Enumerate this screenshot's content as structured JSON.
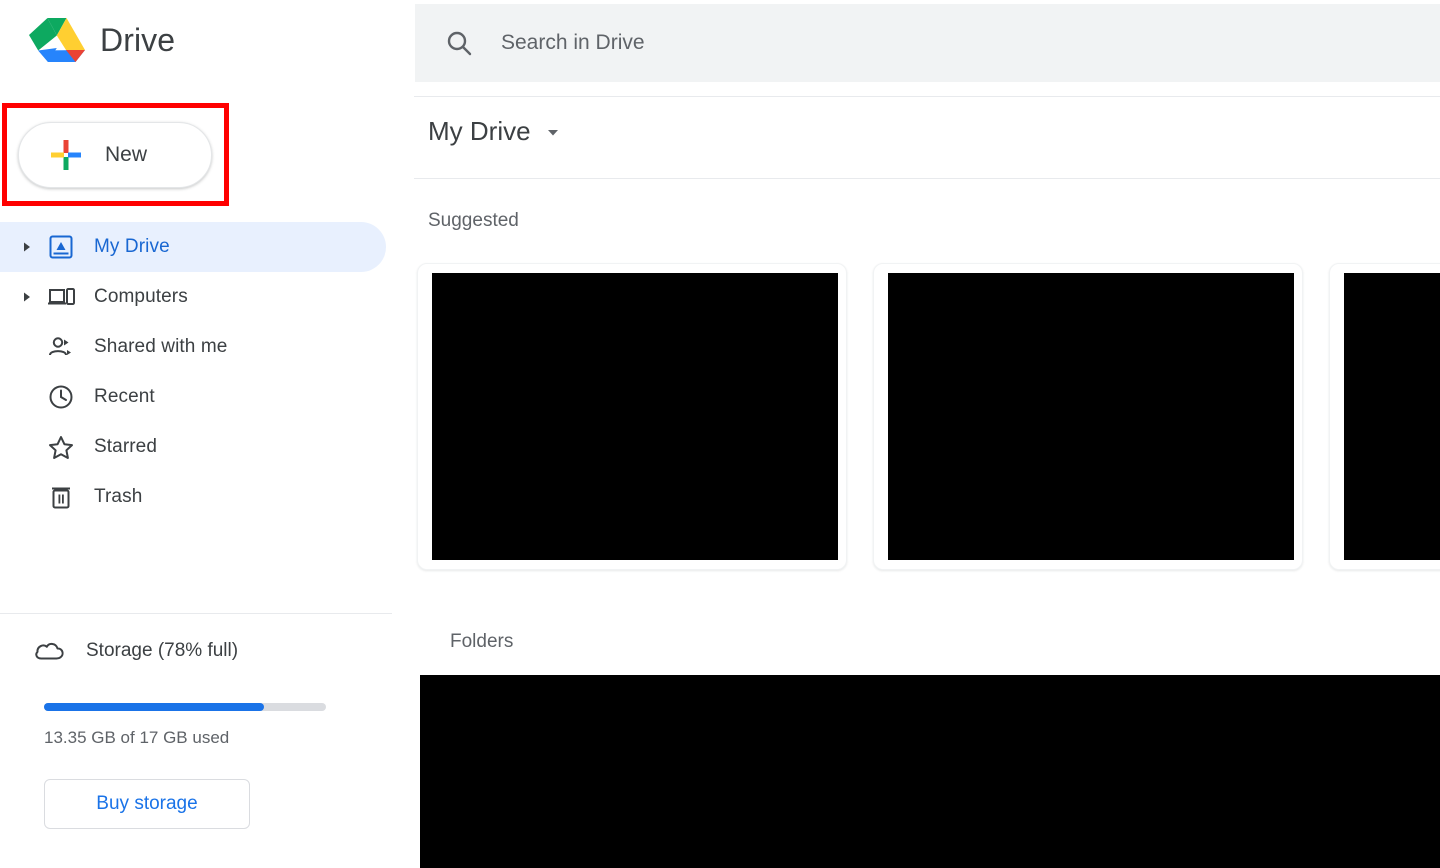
{
  "brand": {
    "name": "Drive",
    "logo_icon": "google-drive-logo",
    "colors": {
      "green": "#0da960",
      "yellow": "#ffcf31",
      "blue": "#2684fc",
      "red": "#ea4335"
    }
  },
  "new_button": {
    "label": "New",
    "icon": "plus-icon",
    "highlight_color": "#ff0000"
  },
  "sidebar": {
    "items": [
      {
        "label": "My Drive",
        "icon": "my-drive-icon",
        "active": true,
        "expandable": true
      },
      {
        "label": "Computers",
        "icon": "computers-icon",
        "active": false,
        "expandable": true
      },
      {
        "label": "Shared with me",
        "icon": "shared-with-me-icon",
        "active": false,
        "expandable": false
      },
      {
        "label": "Recent",
        "icon": "clock-icon",
        "active": false,
        "expandable": false
      },
      {
        "label": "Starred",
        "icon": "star-icon",
        "active": false,
        "expandable": false
      },
      {
        "label": "Trash",
        "icon": "trash-icon",
        "active": false,
        "expandable": false
      }
    ],
    "storage": {
      "icon": "cloud-icon",
      "label": "Storage (78% full)",
      "percent_full": 78,
      "used_text": "13.35 GB of 17 GB used",
      "buy_label": "Buy storage",
      "bar_color": "#1a73e8"
    },
    "active_color": "#1967d2",
    "active_bg": "#e8f0fe"
  },
  "search": {
    "icon": "search-icon",
    "placeholder": "Search in Drive",
    "value": ""
  },
  "content": {
    "breadcrumb": {
      "title": "My Drive",
      "caret_icon": "chevron-down-icon"
    },
    "suggested": {
      "label": "Suggested",
      "cards": [
        {
          "thumbnail": "redacted",
          "title": ""
        },
        {
          "thumbnail": "redacted",
          "title": ""
        },
        {
          "thumbnail": "redacted",
          "title": ""
        }
      ]
    },
    "folders": {
      "label": "Folders",
      "content": "redacted"
    }
  }
}
